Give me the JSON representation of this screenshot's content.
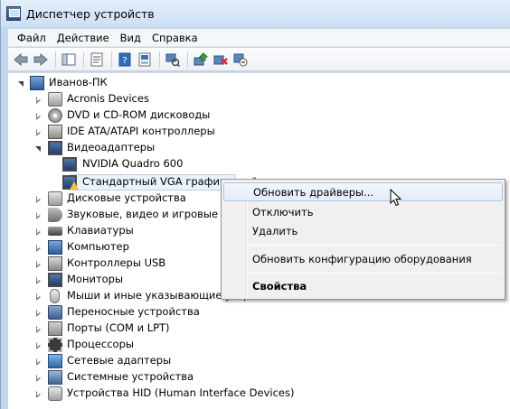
{
  "window": {
    "title": "Диспетчер устройств"
  },
  "menu": {
    "items": [
      {
        "label": "Файл",
        "underline": "Ф"
      },
      {
        "label": "Действие",
        "underline": "Д"
      },
      {
        "label": "Вид",
        "underline": "В"
      },
      {
        "label": "Справка",
        "underline": "С"
      }
    ]
  },
  "toolbar": {
    "buttons": [
      "back-icon",
      "forward-icon",
      "console-tree-icon",
      "properties-icon",
      "help-icon",
      "show-hidden-icon",
      "scan-hardware-icon",
      "update-driver-icon",
      "uninstall-icon",
      "disable-icon"
    ]
  },
  "tree": {
    "root": "Иванов-ПК",
    "nodes": [
      {
        "label": "Acronis Devices",
        "icon": "disk-icon",
        "state": "collapsed"
      },
      {
        "label": "DVD и CD-ROM дисководы",
        "icon": "dvd-icon",
        "state": "collapsed"
      },
      {
        "label": "IDE ATA/ATAPI контроллеры",
        "icon": "ide-icon",
        "state": "collapsed"
      },
      {
        "label": "Видеоадаптеры",
        "icon": "display-icon",
        "state": "expanded",
        "children": [
          {
            "label": "NVIDIA Quadro 600",
            "icon": "display-icon"
          },
          {
            "label": "Стандартный VGA графический",
            "icon": "display-warning-icon",
            "selected": true
          }
        ]
      },
      {
        "label": "Дисковые устройства",
        "icon": "disk-icon",
        "state": "collapsed"
      },
      {
        "label": "Звуковые, видео и игровые устройства",
        "icon": "sound-icon",
        "state": "collapsed"
      },
      {
        "label": "Клавиатуры",
        "icon": "keyboard-icon",
        "state": "collapsed"
      },
      {
        "label": "Компьютер",
        "icon": "computer-icon",
        "state": "collapsed"
      },
      {
        "label": "Контроллеры USB",
        "icon": "usb-icon",
        "state": "collapsed"
      },
      {
        "label": "Мониторы",
        "icon": "monitor-icon",
        "state": "collapsed"
      },
      {
        "label": "Мыши и иные указывающие устройства",
        "icon": "mouse-icon",
        "state": "collapsed"
      },
      {
        "label": "Переносные устройства",
        "icon": "portable-icon",
        "state": "collapsed"
      },
      {
        "label": "Порты (COM и LPT)",
        "icon": "ports-icon",
        "state": "collapsed"
      },
      {
        "label": "Процессоры",
        "icon": "cpu-icon",
        "state": "collapsed"
      },
      {
        "label": "Сетевые адаптеры",
        "icon": "network-icon",
        "state": "collapsed"
      },
      {
        "label": "Системные устройства",
        "icon": "system-icon",
        "state": "collapsed"
      },
      {
        "label": "Устройства HID (Human Interface Devices)",
        "icon": "hid-icon",
        "state": "collapsed"
      }
    ]
  },
  "context_menu": {
    "items": [
      {
        "label": "Обновить драйверы...",
        "hover": true
      },
      {
        "label": "Отключить"
      },
      {
        "label": "Удалить"
      },
      {
        "label": "Обновить конфигурацию оборудования"
      },
      {
        "label": "Свойства",
        "bold": true
      }
    ]
  },
  "colors": {
    "selection": "#eaf2fb",
    "menu_hover_border": "#a8c4e6",
    "warning": "#f1c232"
  }
}
